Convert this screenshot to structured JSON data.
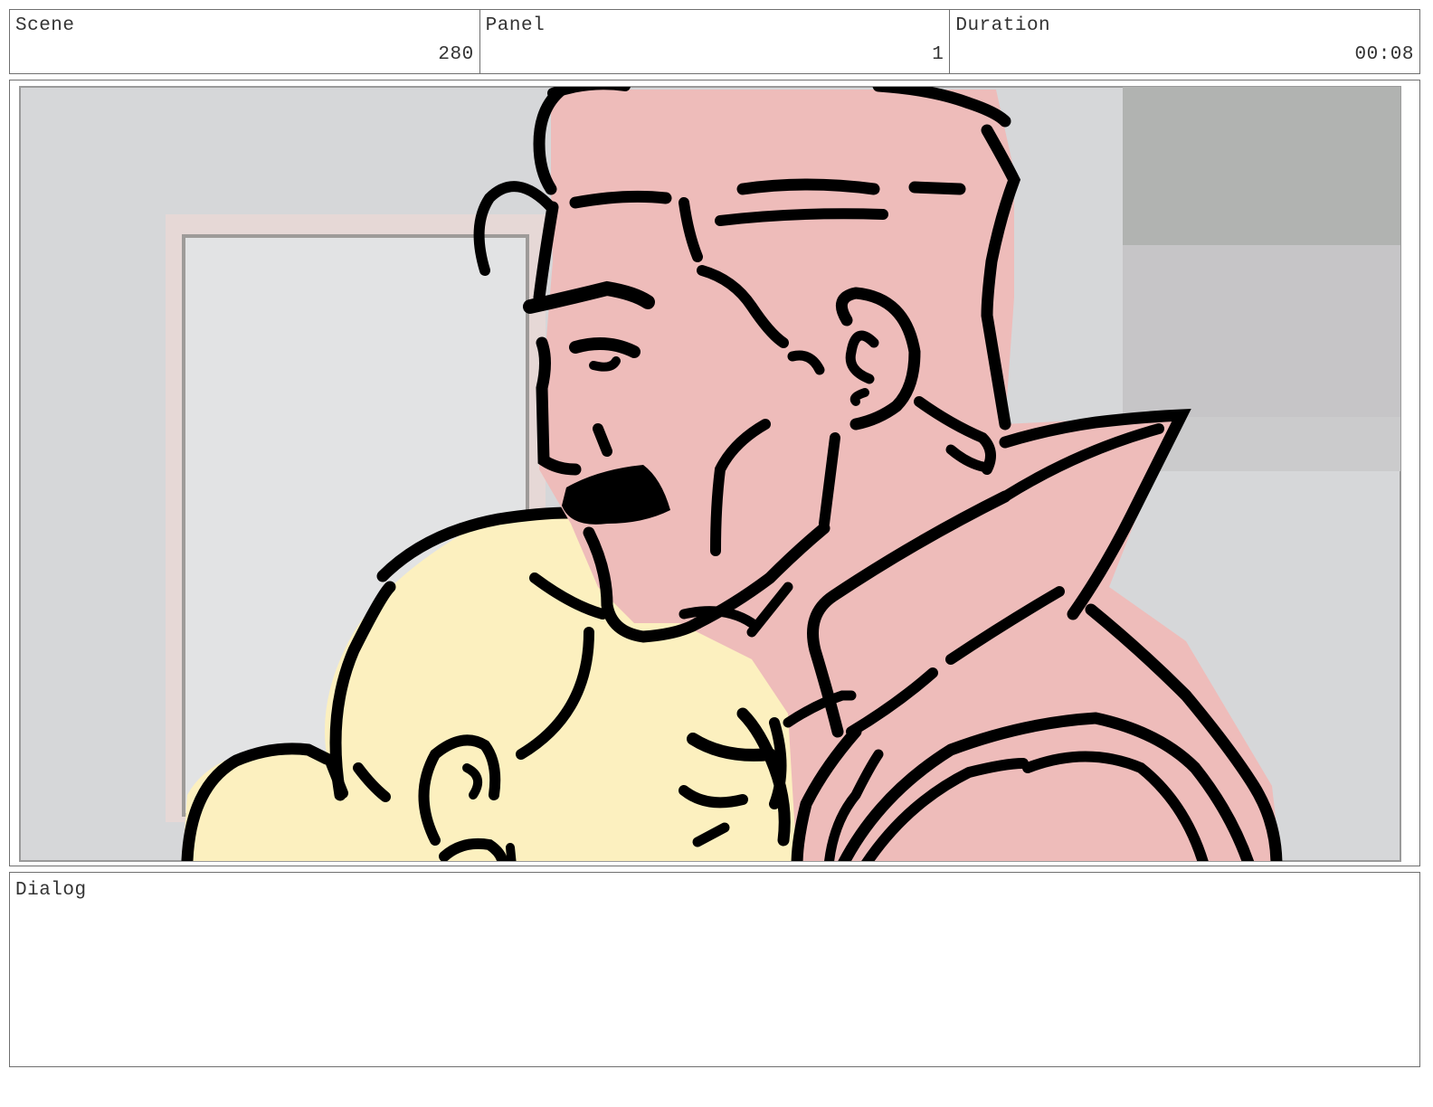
{
  "header": {
    "scene": {
      "label": "Scene",
      "value": "280"
    },
    "panel": {
      "label": "Panel",
      "value": "1"
    },
    "duration": {
      "label": "Duration",
      "value": "00:08"
    }
  },
  "dialog": {
    "label": "Dialog",
    "text": ""
  },
  "colors": {
    "border": "#6f6f6f",
    "wall": "#d6d7d9",
    "frame": "#e5d9d6",
    "man_skin": "#eebcba",
    "child_hair": "#fcf0bf",
    "ink": "#000000"
  }
}
